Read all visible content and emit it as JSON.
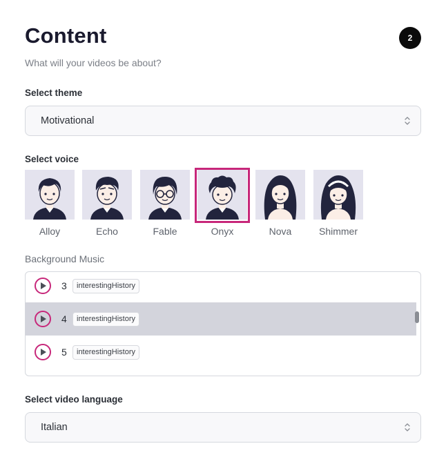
{
  "header": {
    "title": "Content",
    "subtitle": "What will your videos be about?",
    "step": "2"
  },
  "theme": {
    "label": "Select theme",
    "value": "Motivational"
  },
  "voice": {
    "label": "Select voice",
    "selected": "Onyx",
    "options": [
      {
        "name": "Alloy"
      },
      {
        "name": "Echo"
      },
      {
        "name": "Fable"
      },
      {
        "name": "Onyx"
      },
      {
        "name": "Nova"
      },
      {
        "name": "Shimmer"
      }
    ]
  },
  "music": {
    "label": "Background Music",
    "tracks": [
      {
        "number": "3",
        "tag": "interestingHistory"
      },
      {
        "number": "4",
        "tag": "interestingHistory",
        "active": true
      },
      {
        "number": "5",
        "tag": "interestingHistory"
      }
    ]
  },
  "language": {
    "label": "Select video language",
    "value": "Italian"
  },
  "colors": {
    "accent": "#c7277a",
    "active_row": "#d3d4dc",
    "avatar_bg": "#e4e3ee"
  }
}
